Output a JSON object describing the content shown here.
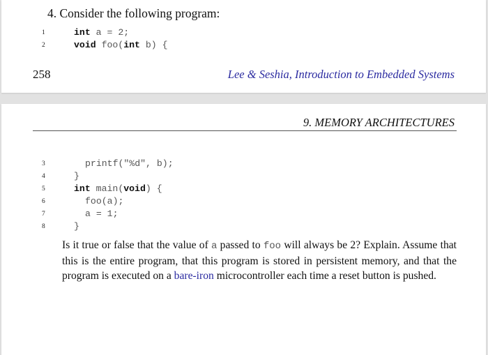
{
  "top_page": {
    "question_heading": "4. Consider the following program:",
    "code_lines": [
      {
        "num": "1",
        "parts": [
          {
            "t": "int",
            "b": true
          },
          {
            "t": " a = 2;",
            "b": false
          }
        ]
      },
      {
        "num": "2",
        "parts": [
          {
            "t": "void",
            "b": true
          },
          {
            "t": " foo(",
            "b": false
          },
          {
            "t": "int",
            "b": true
          },
          {
            "t": " b) {",
            "b": false
          }
        ]
      }
    ],
    "footer": {
      "page_number": "258",
      "running_title": "Lee & Seshia, Introduction to Embedded Systems"
    }
  },
  "bottom_page": {
    "chapter_header": "9. MEMORY ARCHITECTURES",
    "code_lines": [
      {
        "num": "3",
        "indent": 1,
        "parts": [
          {
            "t": "printf(\"%d\", b);",
            "b": false
          }
        ]
      },
      {
        "num": "4",
        "indent": 0,
        "parts": [
          {
            "t": "}",
            "b": false
          }
        ]
      },
      {
        "num": "5",
        "indent": 0,
        "parts": [
          {
            "t": "int",
            "b": true
          },
          {
            "t": " main(",
            "b": false
          },
          {
            "t": "void",
            "b": true
          },
          {
            "t": ") {",
            "b": false
          }
        ]
      },
      {
        "num": "6",
        "indent": 1,
        "parts": [
          {
            "t": "foo(a);",
            "b": false
          }
        ]
      },
      {
        "num": "7",
        "indent": 1,
        "parts": [
          {
            "t": "a = 1;",
            "b": false
          }
        ]
      },
      {
        "num": "8",
        "indent": 0,
        "parts": [
          {
            "t": "}",
            "b": false
          }
        ]
      }
    ],
    "paragraph": {
      "s1": "Is it true or false that the value of ",
      "var_a": "a",
      "s2": " passed to ",
      "func_foo": "foo",
      "s3": " will always be 2?  Explain. Assume that this is the entire program, that this program is stored in persistent memory, and that the program is executed on a ",
      "link_text": "bare-iron",
      "s4": " microcontroller each time a reset button is pushed."
    }
  },
  "colors": {
    "link": "#2a2aa0",
    "background_gap": "#e2e2e2"
  }
}
